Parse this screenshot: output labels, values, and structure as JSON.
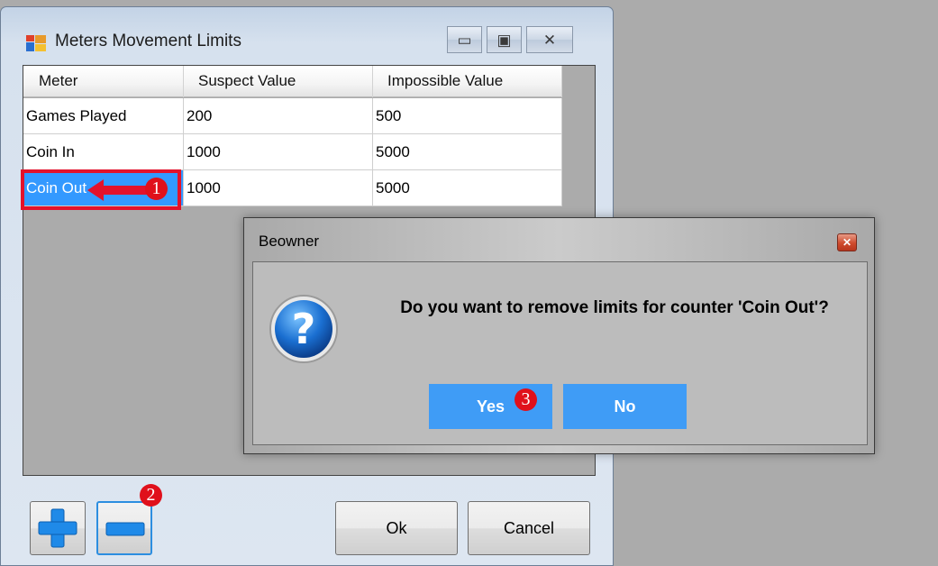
{
  "window": {
    "title": "Meters Movement Limits",
    "minimize_icon": "minimize-icon",
    "maximize_icon": "maximize-icon",
    "close_icon": "close-icon"
  },
  "grid": {
    "columns": [
      "Meter",
      "Suspect Value",
      "Impossible Value"
    ],
    "rows": [
      {
        "meter": "Games Played",
        "suspect": "200",
        "impossible": "500",
        "selected": false
      },
      {
        "meter": "Coin In",
        "suspect": "1000",
        "impossible": "5000",
        "selected": false
      },
      {
        "meter": "Coin Out",
        "suspect": "1000",
        "impossible": "5000",
        "selected": true
      }
    ]
  },
  "annotations": {
    "step1": "1",
    "step2": "2",
    "step3": "3",
    "highlight_color": "#e3122b"
  },
  "buttons": {
    "add_icon": "plus-icon",
    "remove_icon": "minus-icon",
    "ok": "Ok",
    "cancel": "Cancel"
  },
  "dialog": {
    "title": "Beowner",
    "icon": "question-icon",
    "message": "Do you want to remove limits for counter 'Coin Out'?",
    "yes": "Yes",
    "no": "No",
    "button_color": "#3f9cf6"
  }
}
